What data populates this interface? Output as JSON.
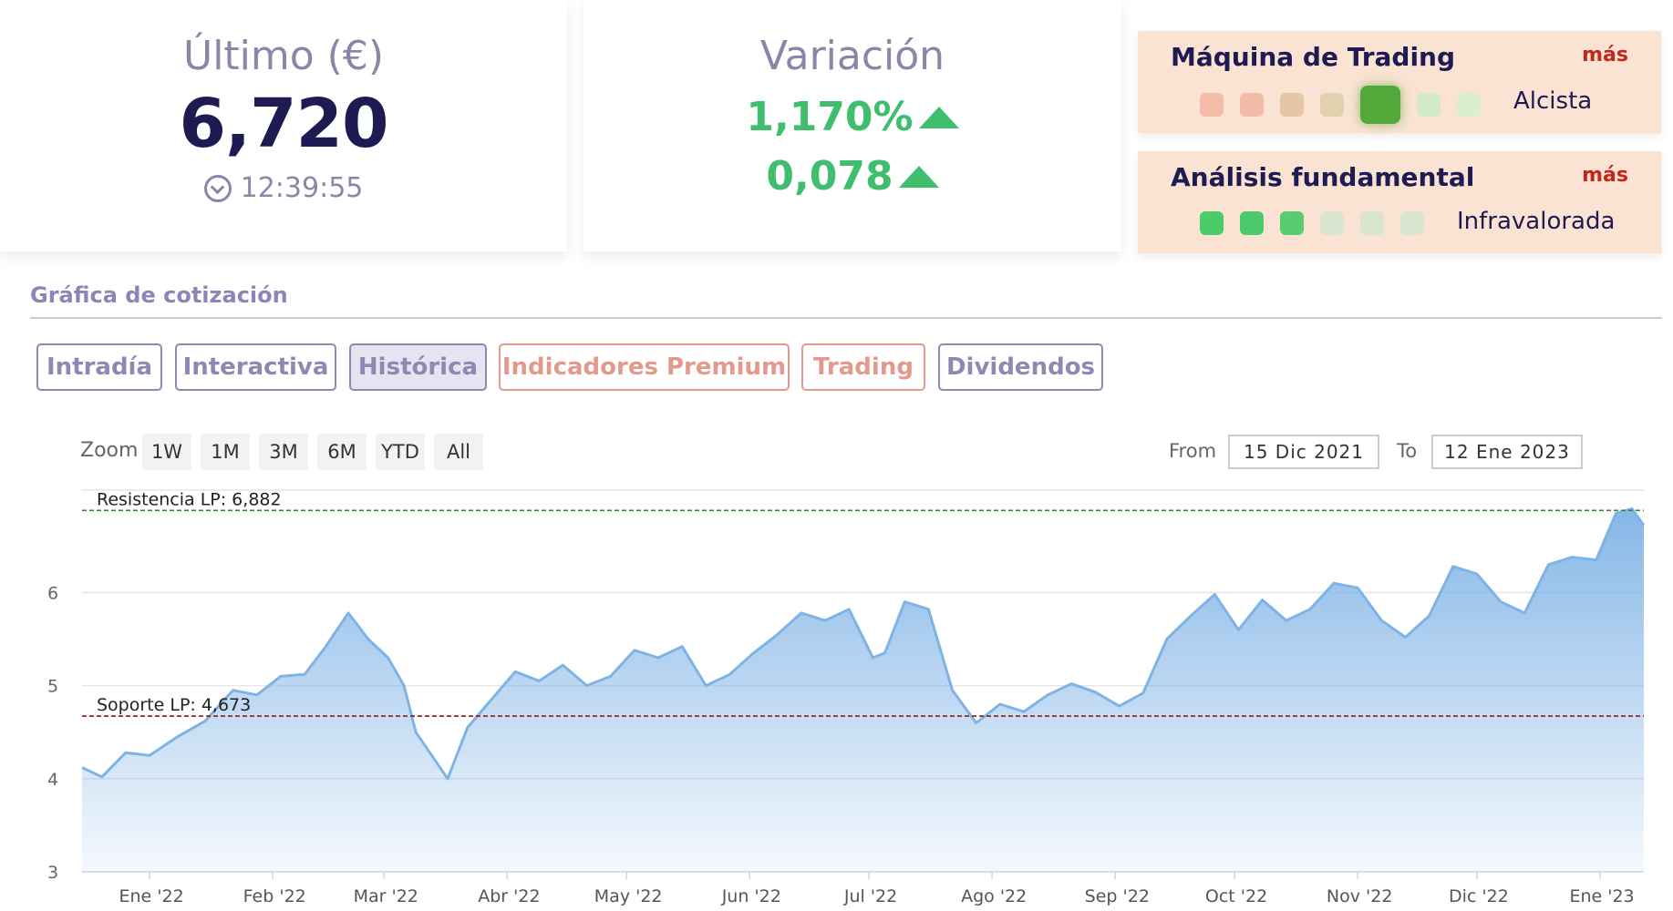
{
  "last_card": {
    "title": "Último (€)",
    "price": "6,720",
    "time": "12:39:55"
  },
  "variation_card": {
    "title": "Variación",
    "percent": "1,170%",
    "abs": "0,078"
  },
  "trading_machine": {
    "title": "Máquina de Trading",
    "more": "más",
    "status": "Alcista",
    "dot_colors": [
      "#f5bda9",
      "#f1bba7",
      "#e7c6a8",
      "#e2d2b0",
      "#52a93a",
      "#d3ebc6",
      "#daefcf"
    ],
    "active_index": 4
  },
  "fundamental": {
    "title": "Análisis fundamental",
    "more": "más",
    "status": "Infravalorada",
    "dot_colors": [
      "#4ccb6a",
      "#4ccb6a",
      "#59cc72",
      "#d9e6cf",
      "#d9e6cf",
      "#d9e6cf"
    ]
  },
  "section_title": "Gráfica de cotización",
  "tabs": [
    {
      "label": "Intradía"
    },
    {
      "label": "Interactiva"
    },
    {
      "label": "Histórica",
      "active": true
    },
    {
      "label": "Indicadores Premium",
      "premium": true
    },
    {
      "label": "Trading",
      "premium": true
    },
    {
      "label": "Dividendos"
    }
  ],
  "zoom": {
    "label": "Zoom",
    "buttons": [
      "1W",
      "1M",
      "3M",
      "6M",
      "YTD",
      "All"
    ]
  },
  "range": {
    "from_label": "From",
    "from_value": "15 Dic 2021",
    "to_label": "To",
    "to_value": "12 Ene 2023"
  },
  "chart_data": {
    "type": "area",
    "x_axis_labels": [
      "Ene '22",
      "Feb '22",
      "Mar '22",
      "Abr '22",
      "May '22",
      "Jun '22",
      "Jul '22",
      "Ago '22",
      "Sep '22",
      "Oct '22",
      "Nov '22",
      "Dic '22",
      "Ene '23"
    ],
    "y_ticks": [
      3,
      4,
      5,
      6
    ],
    "ylim": [
      3,
      7.1
    ],
    "xlim": [
      "2021-12-15",
      "2023-01-12"
    ],
    "grid": true,
    "series_color": "#7fb3e6",
    "resistance": {
      "label": "Resistencia LP: 6,882",
      "value": 6.882,
      "color": "#2e8b2e"
    },
    "support": {
      "label": "Soporte LP: 4,673",
      "value": 4.673,
      "color": "#8b1a1a"
    },
    "x": [
      "2021-12-15",
      "2021-12-20",
      "2021-12-26",
      "2022-01-01",
      "2022-01-08",
      "2022-01-15",
      "2022-01-22",
      "2022-01-28",
      "2022-02-03",
      "2022-02-09",
      "2022-02-14",
      "2022-02-20",
      "2022-02-25",
      "2022-03-02",
      "2022-03-06",
      "2022-03-09",
      "2022-03-13",
      "2022-03-17",
      "2022-03-22",
      "2022-03-28",
      "2022-04-03",
      "2022-04-09",
      "2022-04-15",
      "2022-04-21",
      "2022-04-27",
      "2022-05-03",
      "2022-05-09",
      "2022-05-15",
      "2022-05-21",
      "2022-05-27",
      "2022-06-02",
      "2022-06-08",
      "2022-06-14",
      "2022-06-20",
      "2022-06-26",
      "2022-07-02",
      "2022-07-05",
      "2022-07-10",
      "2022-07-16",
      "2022-07-22",
      "2022-07-28",
      "2022-08-03",
      "2022-08-09",
      "2022-08-15",
      "2022-08-21",
      "2022-08-27",
      "2022-09-02",
      "2022-09-08",
      "2022-09-14",
      "2022-09-20",
      "2022-09-26",
      "2022-10-02",
      "2022-10-08",
      "2022-10-14",
      "2022-10-20",
      "2022-10-26",
      "2022-11-01",
      "2022-11-07",
      "2022-11-13",
      "2022-11-19",
      "2022-11-25",
      "2022-12-01",
      "2022-12-07",
      "2022-12-13",
      "2022-12-19",
      "2022-12-25",
      "2022-12-31",
      "2023-01-05",
      "2023-01-09",
      "2023-01-12"
    ],
    "values": [
      4.12,
      4.02,
      4.28,
      4.25,
      4.45,
      4.62,
      4.95,
      4.9,
      5.1,
      5.12,
      5.4,
      5.78,
      5.5,
      5.3,
      5.0,
      4.5,
      4.25,
      4.0,
      4.55,
      4.85,
      5.15,
      5.05,
      5.22,
      5.0,
      5.1,
      5.38,
      5.3,
      5.42,
      5.0,
      5.12,
      5.35,
      5.55,
      5.78,
      5.7,
      5.82,
      5.3,
      5.35,
      5.9,
      5.82,
      4.95,
      4.6,
      4.8,
      4.72,
      4.9,
      5.02,
      4.93,
      4.78,
      4.92,
      5.5,
      5.75,
      5.98,
      5.6,
      5.92,
      5.7,
      5.82,
      6.1,
      6.05,
      5.7,
      5.52,
      5.75,
      6.28,
      6.2,
      5.9,
      5.78,
      6.3,
      6.38,
      6.35,
      6.85,
      6.9,
      6.72
    ]
  }
}
